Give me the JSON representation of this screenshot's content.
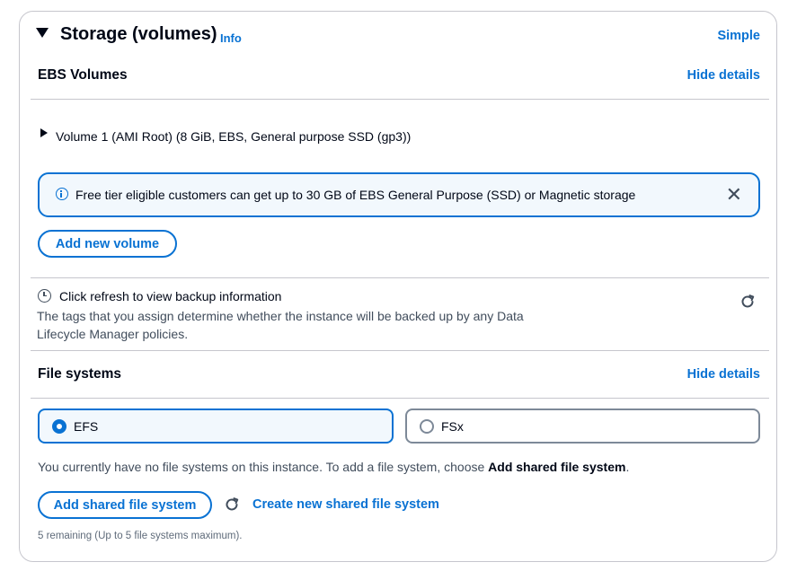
{
  "storage": {
    "title": "Storage (volumes)",
    "info_label": "Info",
    "simple_label": "Simple"
  },
  "ebs": {
    "title": "EBS Volumes",
    "hide_label": "Hide details",
    "volume_label": "Volume 1 (AMI Root) (8 GiB, EBS, General purpose SSD (gp3))",
    "alert_text": "Free tier eligible customers can get up to 30 GB of EBS General Purpose (SSD) or Magnetic storage",
    "add_volume_label": "Add new volume"
  },
  "backup": {
    "title": "Click refresh to view backup information",
    "description": "The tags that you assign determine whether the instance will be backed up by any Data Lifecycle Manager policies."
  },
  "file_systems": {
    "title": "File systems",
    "hide_label": "Hide details",
    "options": [
      {
        "label": "EFS",
        "selected": true
      },
      {
        "label": "FSx",
        "selected": false
      }
    ],
    "note_prefix": "You currently have no file systems on this instance. To add a file system, choose ",
    "note_bold": "Add shared file system",
    "note_suffix": ".",
    "add_label": "Add shared file system",
    "create_label": "Create new shared file system",
    "remaining": "5 remaining (Up to 5 file systems maximum)."
  },
  "colors": {
    "accent": "#0972d3",
    "alert_bg": "#f2f8fd",
    "border": "#c6c6cd",
    "text": "#000716"
  }
}
